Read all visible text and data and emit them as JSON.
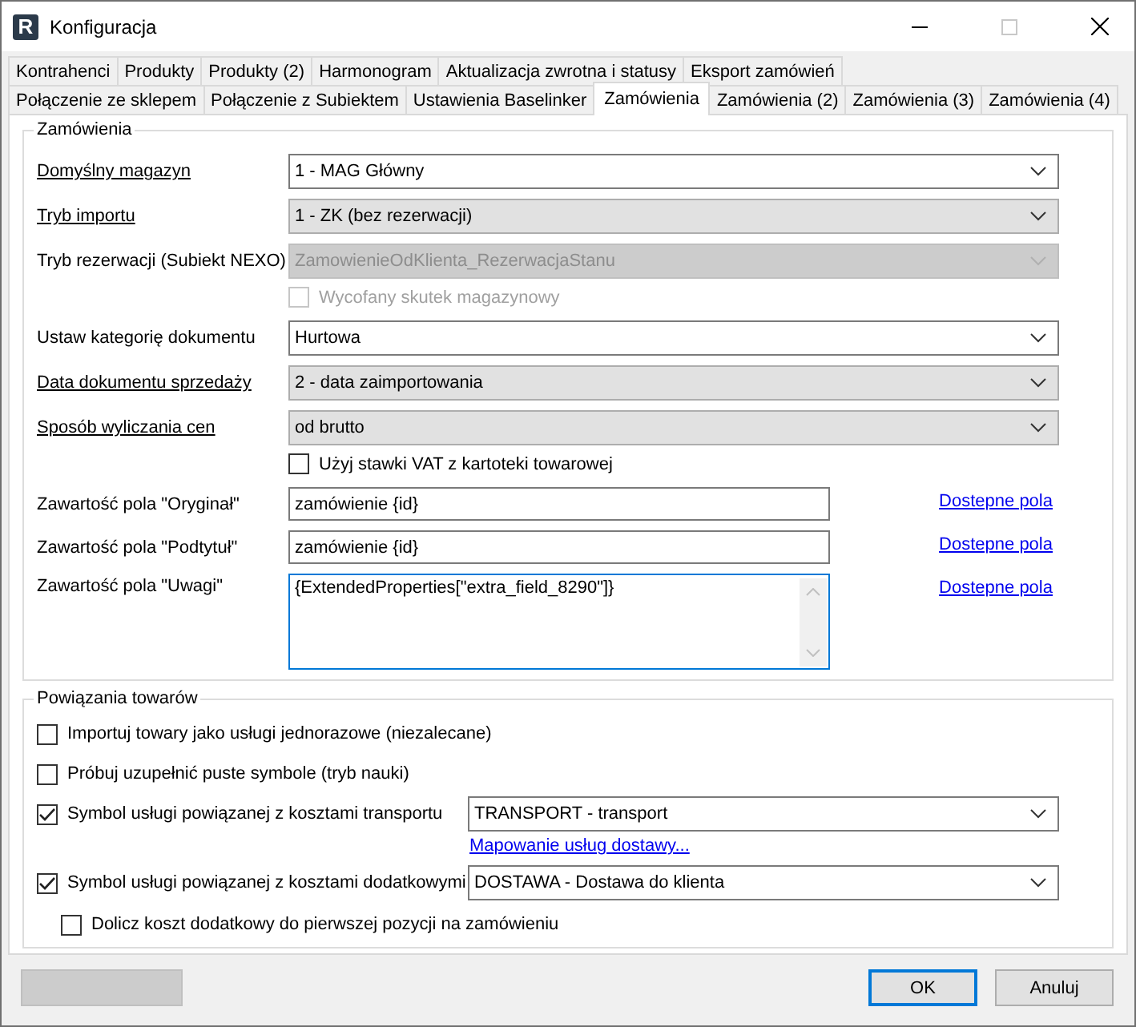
{
  "window": {
    "title": "Konfiguracja",
    "icon_letter": "R",
    "maximize_disabled": true
  },
  "tab_rows": [
    [
      {
        "label": "Kontrahenci",
        "selected": false
      },
      {
        "label": "Produkty",
        "selected": false
      },
      {
        "label": "Produkty (2)",
        "selected": false
      },
      {
        "label": "Harmonogram",
        "selected": false
      },
      {
        "label": "Aktualizacja zwrotna i statusy",
        "selected": false
      },
      {
        "label": "Eksport zamówień",
        "selected": false
      }
    ],
    [
      {
        "label": "Połączenie ze sklepem",
        "selected": false
      },
      {
        "label": "Połączenie z Subiektem",
        "selected": false
      },
      {
        "label": "Ustawienia Baselinker",
        "selected": false
      },
      {
        "label": "Zamówienia",
        "selected": true
      },
      {
        "label": "Zamówienia (2)",
        "selected": false
      },
      {
        "label": "Zamówienia (3)",
        "selected": false
      },
      {
        "label": "Zamówienia (4)",
        "selected": false
      }
    ]
  ],
  "orders_group": {
    "title": "Zamówienia",
    "rows": [
      {
        "kind": "combo",
        "label": "Domyślny magazyn",
        "label_underlined": true,
        "value": "1 - MAG Główny",
        "editable": true,
        "disabled": false
      },
      {
        "kind": "combo",
        "label": "Tryb importu",
        "label_underlined": true,
        "value": "1 - ZK (bez rezerwacji)",
        "editable": false,
        "disabled": false
      },
      {
        "kind": "combo",
        "label": "Tryb rezerwacji (Subiekt NEXO)",
        "label_underlined": false,
        "value": "ZamowienieOdKlienta_RezerwacjaStanu",
        "editable": false,
        "disabled": true
      },
      {
        "kind": "checkbox",
        "label": "Wycofany skutek magazynowy",
        "checked": false,
        "disabled": true
      },
      {
        "kind": "combo",
        "label": "Ustaw kategorię dokumentu",
        "label_underlined": false,
        "value": "Hurtowa",
        "editable": true,
        "disabled": false
      },
      {
        "kind": "combo",
        "label": "Data dokumentu sprzedaży",
        "label_underlined": true,
        "value": "2 - data zaimportowania",
        "editable": false,
        "disabled": false
      },
      {
        "kind": "combo",
        "label": "Sposób wyliczania cen",
        "label_underlined": true,
        "value": "od brutto",
        "editable": false,
        "disabled": false
      },
      {
        "kind": "checkbox",
        "label": "Użyj stawki VAT z kartoteki towarowej",
        "checked": false,
        "disabled": false
      },
      {
        "kind": "text",
        "label": "Zawartość pola \"Oryginał\"",
        "value": "zamówienie {id}",
        "link": "Dostepne pola",
        "focused": false
      },
      {
        "kind": "text",
        "label": "Zawartość pola \"Podtytuł\"",
        "value": "zamówienie {id}",
        "link": "Dostepne pola",
        "focused": false
      },
      {
        "kind": "textarea",
        "label": "Zawartość pola \"Uwagi\"",
        "value": "{ExtendedProperties[\"extra_field_8290\"]}",
        "link": "Dostepne pola",
        "focused": true
      }
    ]
  },
  "products_group": {
    "title": "Powiązania towarów",
    "rows": [
      {
        "kind": "checkbox",
        "label": "Importuj towary jako usługi jednorazowe (niezalecane)",
        "checked": false
      },
      {
        "kind": "checkbox",
        "label": "Próbuj uzupełnić puste symbole (tryb nauki)",
        "checked": false
      },
      {
        "kind": "checkbox_combo",
        "label": "Symbol usługi powiązanej z kosztami transportu",
        "checked": true,
        "value": "TRANSPORT - transport",
        "link": "Mapowanie usług dostawy..."
      },
      {
        "kind": "checkbox_combo",
        "label": "Symbol usługi powiązanej z kosztami dodatkowymi",
        "checked": true,
        "value": "DOSTAWA - Dostawa do klienta",
        "children": [
          {
            "label": "Dolicz koszt dodatkowy do pierwszej pozycji na zamówieniu",
            "checked": false
          }
        ]
      }
    ]
  },
  "buttons": [
    {
      "kind": "blank",
      "disabled": true
    },
    {
      "kind": "text",
      "label": "OK",
      "default": true
    },
    {
      "kind": "text",
      "label": "Anuluj",
      "default": false
    }
  ]
}
